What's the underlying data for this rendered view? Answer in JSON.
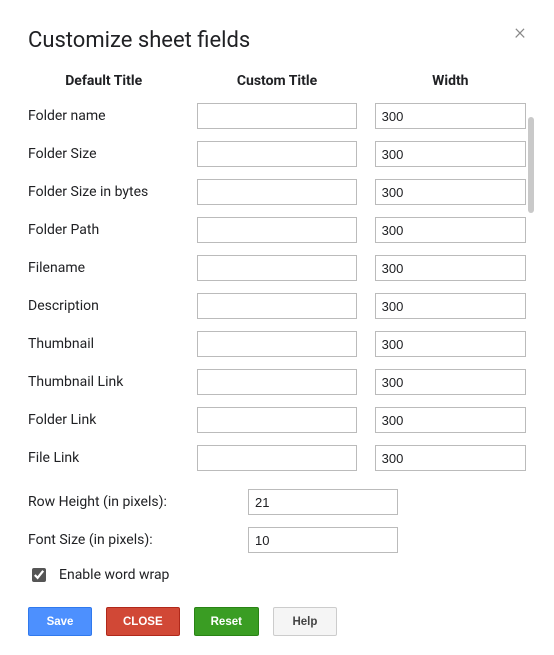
{
  "dialog": {
    "title": "Customize sheet fields"
  },
  "headers": {
    "default_title": "Default Title",
    "custom_title": "Custom Title",
    "width": "Width"
  },
  "fields": [
    {
      "default": "Folder name",
      "custom": "",
      "width": "300"
    },
    {
      "default": "Folder Size",
      "custom": "",
      "width": "300"
    },
    {
      "default": "Folder Size in bytes",
      "custom": "",
      "width": "300"
    },
    {
      "default": "Folder Path",
      "custom": "",
      "width": "300"
    },
    {
      "default": "Filename",
      "custom": "",
      "width": "300"
    },
    {
      "default": "Description",
      "custom": "",
      "width": "300"
    },
    {
      "default": "Thumbnail",
      "custom": "",
      "width": "300"
    },
    {
      "default": "Thumbnail Link",
      "custom": "",
      "width": "300"
    },
    {
      "default": "Folder Link",
      "custom": "",
      "width": "300"
    },
    {
      "default": "File Link",
      "custom": "",
      "width": "300"
    }
  ],
  "params": {
    "row_height_label": "Row Height (in pixels):",
    "row_height_value": "21",
    "font_size_label": "Font Size (in pixels):",
    "font_size_value": "10"
  },
  "wordwrap": {
    "label": "Enable word wrap",
    "checked": true
  },
  "buttons": {
    "save": "Save",
    "close": "CLOSE",
    "reset": "Reset",
    "help": "Help"
  }
}
